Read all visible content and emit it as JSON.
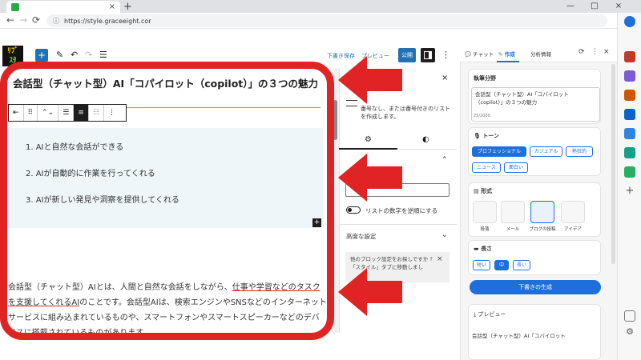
{
  "browser": {
    "tab_title": "",
    "tab_close": "×",
    "new_tab": "+",
    "url": "https://style.graceeight.cor",
    "window_controls": [
      "—",
      "□",
      "×"
    ],
    "nav": [
      "←",
      "→",
      "⟳"
    ]
  },
  "wp_toolbar": {
    "logo_top": "ﾘﾌﾞ",
    "logo_bottom": "ｽﾀ",
    "add": "+",
    "save_draft": "下書き保存",
    "preview": "プレビュー",
    "publish": "公開",
    "more": "⋮",
    "tools": [
      "✎",
      "↶",
      "↷",
      "☰"
    ]
  },
  "editor": {
    "heading": "会話型（チャット型）AI「コパイロット（copilot）」の３つの魅力",
    "block_tools": [
      "⇤",
      "⠿",
      "⌃⌄",
      "☰",
      "≡",
      "☷",
      "⋮"
    ],
    "list_items": [
      "1. AIと自然な会話ができる",
      "2. AIが自動的に作業を行ってくれる",
      "3. AIが新しい発見や洞察を提供してくれる"
    ],
    "inline_add": "+",
    "paragraph_start": "会話型（チャット型）AIとは、人間と自然な会話をしながら、",
    "paragraph_ul1": "仕事や学習などのタスクを支援してくれるAI",
    "paragraph_mid": "のことです。会話型AIは、検索エンジンやSNSなどのインターネットサービスに組み込まれているものや、スマートフォンやスマートスピーカーなどのデバイスに搭載されているものがあります。"
  },
  "settings_panel": {
    "close": "×",
    "description": "番号なし、または番号付きのリストを作成します。",
    "tab_settings": "⚙",
    "tab_styles": "◐",
    "chevron": "⌃",
    "toggle_label": "リストの数字を逆順にする",
    "advanced": "高度な設定",
    "advanced_chevron": "⌄",
    "notice": "他のブロック設定をお探しですか ?「スタイル」タブに移動しまし",
    "notice_close": "×"
  },
  "copilot": {
    "tabs": [
      "チャット",
      "作成",
      "分析情報"
    ],
    "header_icons": [
      "⟳",
      "⋮",
      "×"
    ],
    "topic_title": "執筆分野",
    "topic_text": "会話型（チャット型）AI「コパイロット（copilot）」の３つの魅力",
    "topic_count": "25/2000",
    "tone_title": "トーン",
    "tones": [
      "プロフェッショナル",
      "カジュアル",
      "熱狂的",
      "ニュース",
      "面白い"
    ],
    "format_title": "形式",
    "formats": [
      "段落",
      "メール",
      "ブログの投稿",
      "アイデア"
    ],
    "length_title": "長さ",
    "lengths": [
      "短い",
      "中",
      "長い"
    ],
    "generate": "下書きの生成",
    "preview_title": "プレビュー",
    "preview_text": "会話型（チャット型）AI「コパイロット"
  },
  "colors": {
    "annotation_red": "#e02424",
    "wp_blue": "#2271b1",
    "copilot_blue": "#1e6fd9"
  }
}
